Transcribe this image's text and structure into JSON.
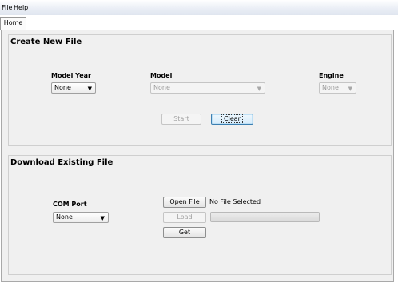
{
  "menu": {
    "file": "File",
    "help": "Help"
  },
  "tabs": [
    {
      "label": "Home"
    }
  ],
  "create": {
    "title": "Create New File",
    "model_year": {
      "label": "Model Year",
      "value": "None"
    },
    "model": {
      "label": "Model",
      "value": "None"
    },
    "engine": {
      "label": "Engine",
      "value": "None"
    },
    "start_label": "Start",
    "clear_label": "Clear"
  },
  "download": {
    "title": "Download Existing File",
    "com_port": {
      "label": "COM Port",
      "value": "None"
    },
    "open_file_label": "Open File",
    "file_status": "No File Selected",
    "load_label": "Load",
    "get_label": "Get",
    "progress": 0
  },
  "icons": {
    "dropdown": "chevron-down-icon"
  }
}
